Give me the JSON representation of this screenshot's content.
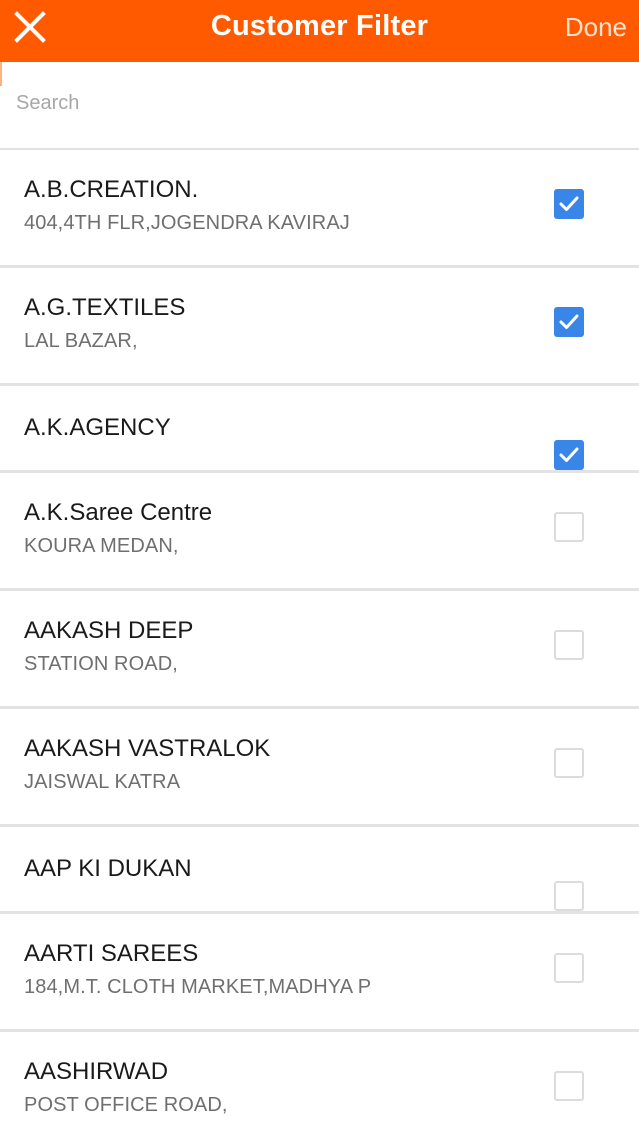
{
  "header": {
    "title": "Customer Filter",
    "done_label": "Done",
    "background_color": "#ff5a00"
  },
  "search": {
    "placeholder": "Search",
    "value": ""
  },
  "customers": [
    {
      "name": "A.B.CREATION.",
      "address": "404,4TH FLR,JOGENDRA KAVIRAJ",
      "checked": true
    },
    {
      "name": "A.G.TEXTILES",
      "address": "LAL BAZAR,",
      "checked": true
    },
    {
      "name": "A.K.AGENCY",
      "address": "",
      "checked": true
    },
    {
      "name": "A.K.Saree Centre",
      "address": "KOURA MEDAN,",
      "checked": false
    },
    {
      "name": "AAKASH DEEP",
      "address": "STATION ROAD,",
      "checked": false
    },
    {
      "name": "AAKASH VASTRALOK",
      "address": "JAISWAL KATRA",
      "checked": false
    },
    {
      "name": "AAP KI DUKAN",
      "address": "",
      "checked": false
    },
    {
      "name": "AARTI SAREES",
      "address": "184,M.T. CLOTH MARKET,MADHYA P",
      "checked": false
    },
    {
      "name": "AASHIRWAD",
      "address": "POST OFFICE ROAD,",
      "checked": false
    }
  ],
  "icons": {
    "close": "close-icon",
    "check": "checkmark-icon"
  },
  "colors": {
    "checkbox_checked": "#3a86e8",
    "divider": "#e3e3e3"
  }
}
